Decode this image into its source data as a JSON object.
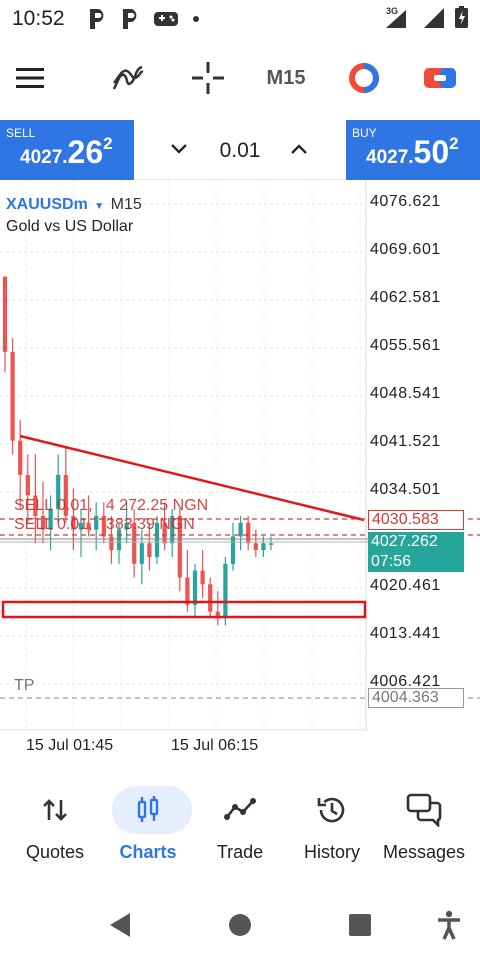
{
  "status_bar": {
    "time": "10:52",
    "icons": [
      "p-app-icon",
      "p-app-icon",
      "gamepad-icon",
      "dot-icon",
      "signal-3g-icon",
      "signal-icon",
      "battery-icon"
    ],
    "network_label": "3G"
  },
  "toolbar": {
    "icons": [
      "menu-icon",
      "indicators-icon",
      "crosshair-icon",
      "timeframe",
      "objects-icon",
      "trade-icon"
    ],
    "timeframe": "M15"
  },
  "trade_bar": {
    "sell_label": "SELL",
    "sell_price_small": "4027.",
    "sell_price_big": "26",
    "sell_price_sup": "2",
    "buy_label": "BUY",
    "buy_price_small": "4027.",
    "buy_price_big": "50",
    "buy_price_sup": "2",
    "lot": "0.01"
  },
  "chart": {
    "symbol": "XAUUSDm",
    "timeframe": "M15",
    "description": "Gold vs US Dollar",
    "price_scale": [
      "4076.621",
      "4069.601",
      "4062.581",
      "4055.561",
      "4048.541",
      "4041.521",
      "4034.501",
      "4020.461",
      "4013.441",
      "4006.421"
    ],
    "sell_line_price": "4030.583",
    "current_price": "4027.262",
    "countdown": "07:56",
    "tp_label": "TP",
    "tp_price": "4004.363",
    "order_label_1": "SELL 0.01,   4 272.25 NGN",
    "order_label_2": "SELL 0.01,   383.39 NGN",
    "time_labels": [
      "15 Jul 01:45",
      "15 Jul 06:15"
    ],
    "colors": {
      "bull": "#26a69a",
      "bear": "#ef5350",
      "trendline": "#e0161b",
      "sell_line": "#d23a3a",
      "accent": "#2f76e4"
    }
  },
  "bottom_nav": {
    "items": [
      {
        "label": "Quotes",
        "icon": "quotes-icon"
      },
      {
        "label": "Charts",
        "icon": "charts-icon",
        "active": true
      },
      {
        "label": "Trade",
        "icon": "trade-chart-icon"
      },
      {
        "label": "History",
        "icon": "history-icon"
      },
      {
        "label": "Messages",
        "icon": "messages-icon"
      }
    ]
  },
  "system_nav": [
    "back-icon",
    "home-icon",
    "recents-icon",
    "accessibility-icon"
  ]
}
